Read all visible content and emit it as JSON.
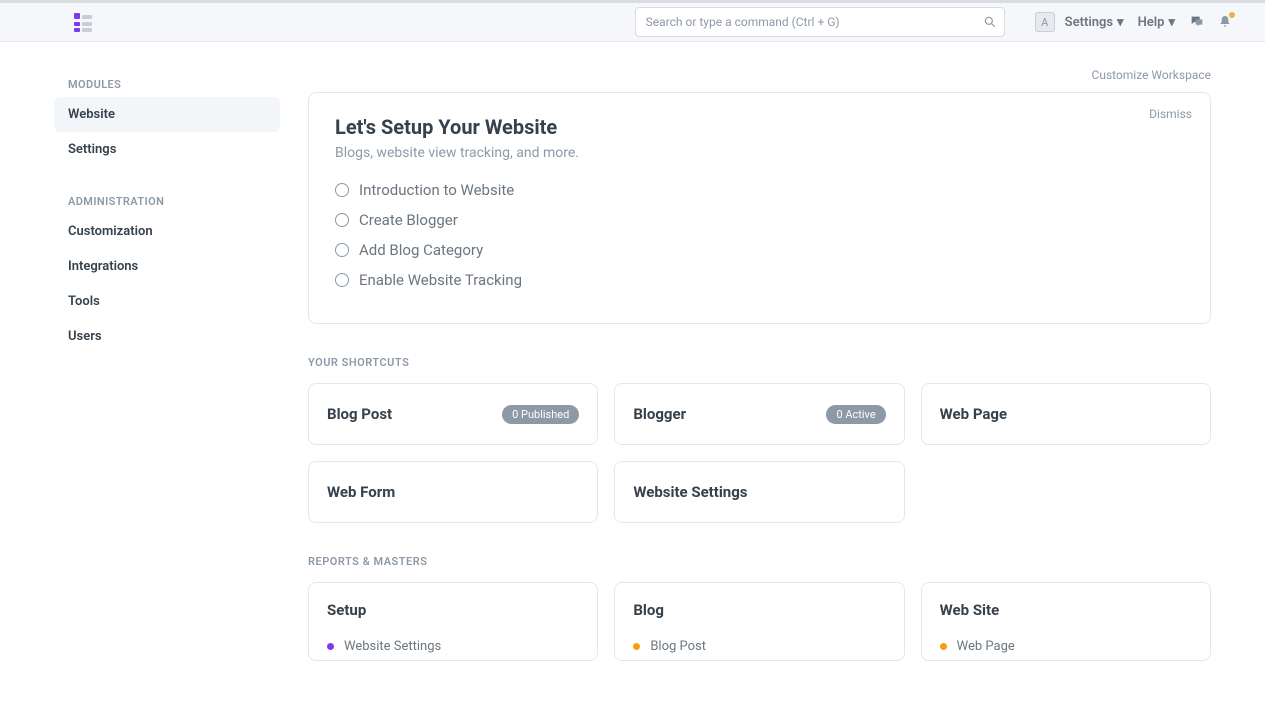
{
  "navbar": {
    "search_placeholder": "Search or type a command (Ctrl + G)",
    "avatar_letter": "A",
    "settings": "Settings",
    "help": "Help"
  },
  "sidebar": {
    "sections": [
      {
        "title": "MODULES",
        "items": [
          {
            "label": "Website",
            "active": true
          },
          {
            "label": "Settings",
            "active": false
          }
        ]
      },
      {
        "title": "ADMINISTRATION",
        "items": [
          {
            "label": "Customization",
            "active": false
          },
          {
            "label": "Integrations",
            "active": false
          },
          {
            "label": "Tools",
            "active": false
          },
          {
            "label": "Users",
            "active": false
          }
        ]
      }
    ]
  },
  "workspace": {
    "customize": "Customize Workspace"
  },
  "setup": {
    "title": "Let's Setup Your Website",
    "subtitle": "Blogs, website view tracking, and more.",
    "dismiss": "Dismiss",
    "steps": [
      "Introduction to Website",
      "Create Blogger",
      "Add Blog Category",
      "Enable Website Tracking"
    ]
  },
  "shortcuts_title": "YOUR SHORTCUTS",
  "shortcuts": [
    {
      "label": "Blog Post",
      "badge": "0 Published"
    },
    {
      "label": "Blogger",
      "badge": "0 Active"
    },
    {
      "label": "Web Page",
      "badge": ""
    },
    {
      "label": "Web Form",
      "badge": ""
    },
    {
      "label": "Website Settings",
      "badge": ""
    }
  ],
  "reports_title": "REPORTS & MASTERS",
  "reports": [
    {
      "title": "Setup",
      "color": "#7c3aed",
      "items": [
        "Website Settings"
      ]
    },
    {
      "title": "Blog",
      "color": "#f59e0b",
      "items": [
        "Blog Post"
      ]
    },
    {
      "title": "Web Site",
      "color": "#f59e0b",
      "items": [
        "Web Page"
      ]
    }
  ]
}
